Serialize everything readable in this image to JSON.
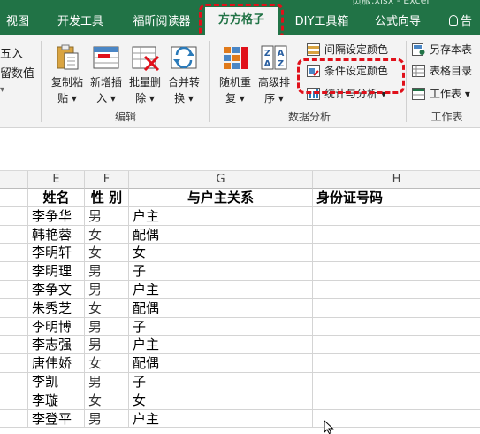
{
  "window": {
    "title": "员服.xlsx - Excel"
  },
  "tabs": [
    {
      "label": "视图"
    },
    {
      "label": "开发工具"
    },
    {
      "label": "福昕阅读器"
    },
    {
      "label": "方方格子",
      "active": true
    },
    {
      "label": "DIY工具箱"
    },
    {
      "label": "公式向导"
    }
  ],
  "tell_me": {
    "label": "告"
  },
  "ribbon": {
    "left_partial": {
      "line1": "五入",
      "line2": "留数值"
    },
    "edit_group": {
      "label": "编辑",
      "buttons": [
        {
          "label": "复制粘\n贴 ▾"
        },
        {
          "label": "新增插\n入 ▾"
        },
        {
          "label": "批量删\n除 ▾"
        },
        {
          "label": "合并转\n换 ▾"
        }
      ]
    },
    "data_group": {
      "label": "数据分析",
      "buttons": [
        {
          "label": "随机重\n复 ▾"
        },
        {
          "label": "高级排\n序 ▾"
        }
      ],
      "small_buttons": [
        {
          "label": "间隔设定颜色"
        },
        {
          "label": "条件设定颜色"
        },
        {
          "label": "统计与分析 ▾"
        }
      ]
    },
    "workbook_group": {
      "label": "工作表",
      "small_buttons": [
        {
          "label": "另存本表"
        },
        {
          "label": "表格目录"
        },
        {
          "label": "工作表 ▾"
        }
      ]
    }
  },
  "columns": [
    "E",
    "F",
    "G",
    "H"
  ],
  "table": {
    "headers": [
      "姓名",
      "性 别",
      "与户主关系",
      "身份证号码"
    ],
    "rows": [
      [
        "李争华",
        "男",
        "户主"
      ],
      [
        "韩艳蓉",
        "女",
        "配偶"
      ],
      [
        "李明轩",
        "女",
        "女"
      ],
      [
        "李明理",
        "男",
        "子"
      ],
      [
        "李争文",
        "男",
        "户主"
      ],
      [
        "朱秀芝",
        "女",
        "配偶"
      ],
      [
        "李明博",
        "男",
        "子"
      ],
      [
        "李志强",
        "男",
        "户主"
      ],
      [
        "唐伟娇",
        "女",
        "配偶"
      ],
      [
        "李凯",
        "男",
        "子"
      ],
      [
        "李璇",
        "女",
        "女"
      ],
      [
        "李登平",
        "男",
        "户主"
      ]
    ]
  },
  "colors": {
    "brand": "#217346",
    "highlight": "#e0101a",
    "ribbon_bg": "#f3f3f3"
  }
}
